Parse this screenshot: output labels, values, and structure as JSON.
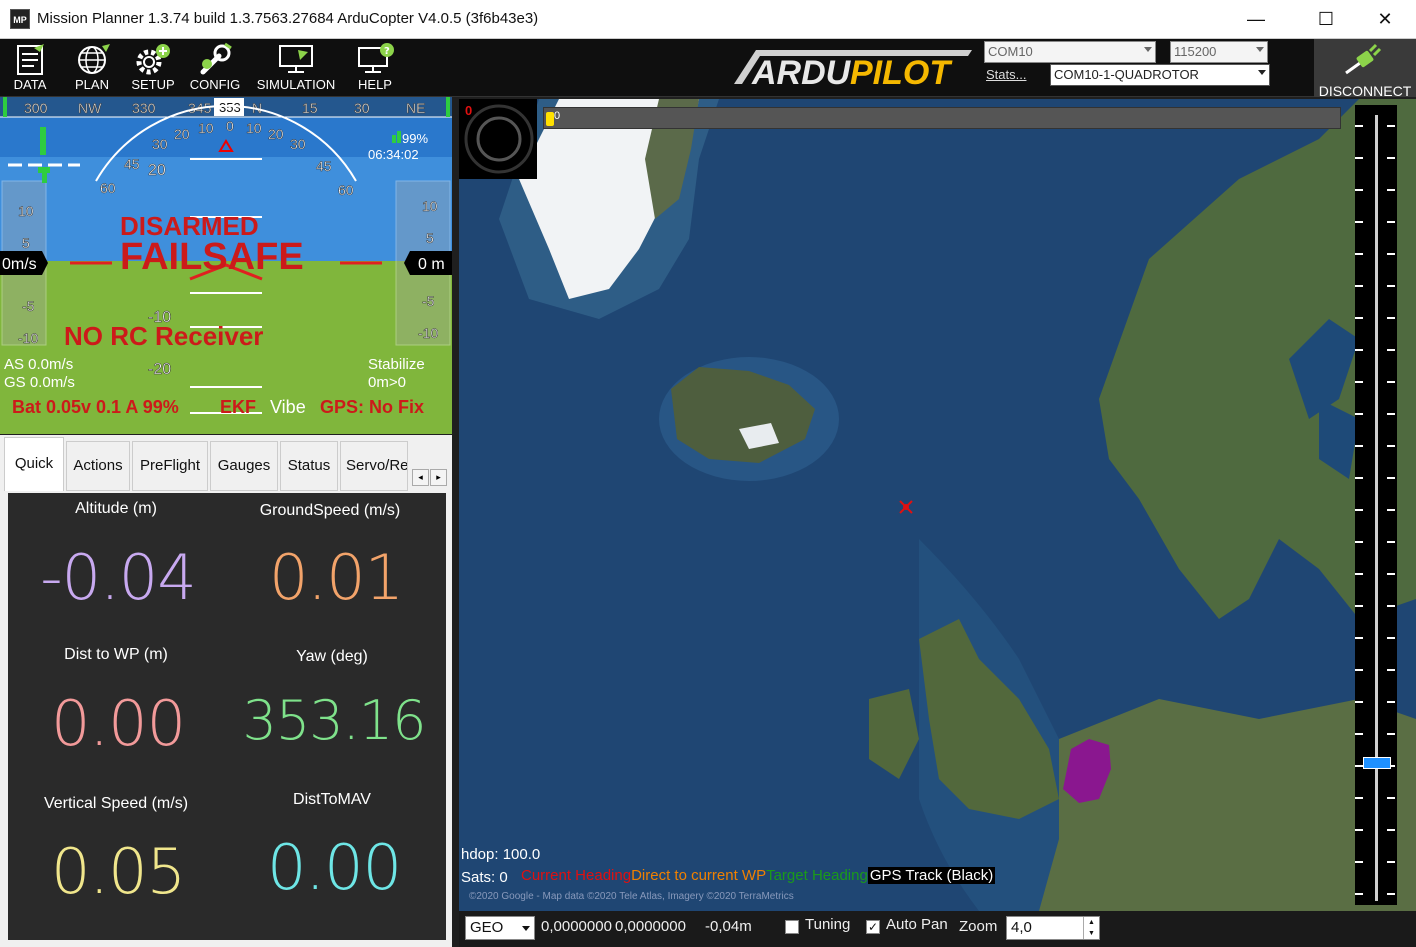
{
  "window": {
    "title": "Mission Planner 1.3.74 build 1.3.7563.27684 ArduCopter V4.0.5 (3f6b43e3)",
    "app_icon_text": "MP",
    "minimize": "—",
    "maximize": "☐",
    "close": "✕"
  },
  "toolbar": {
    "buttons": [
      {
        "label": "DATA",
        "icon": "data-icon"
      },
      {
        "label": "PLAN",
        "icon": "globe-icon"
      },
      {
        "label": "SETUP",
        "icon": "gear-plus-icon"
      },
      {
        "label": "CONFIG",
        "icon": "wrench-icon"
      },
      {
        "label": "SIMULATION",
        "icon": "monitor-icon"
      },
      {
        "label": "HELP",
        "icon": "help-monitor-icon"
      }
    ],
    "logo_text": "ARDUPILOT",
    "port": "COM10",
    "baud": "115200",
    "stats_link": "Stats...",
    "device": "COM10-1-QUADROTOR",
    "disconnect_label": "DISCONNECT"
  },
  "hud": {
    "heading_ticks": [
      "300",
      "NW",
      "330",
      "345",
      "353",
      "N",
      "15",
      "30",
      "NE"
    ],
    "heading_value": "353",
    "roll_ticks_left": [
      "60",
      "45",
      "30",
      "20",
      "10"
    ],
    "roll_ticks_right": [
      "0",
      "10",
      "20",
      "30",
      "45",
      "60"
    ],
    "pitch_marks": [
      "20",
      "-10",
      "-20"
    ],
    "speed_scale": [
      "10",
      "5",
      "-5",
      "-10"
    ],
    "speed_value": "0m/s",
    "alt_scale": [
      "10",
      "5",
      "-5",
      "-10"
    ],
    "alt_value": "0 m",
    "signal_pct": "99%",
    "time": "06:34:02",
    "status_disarmed": "DISARMED",
    "status_failsafe": "FAILSAFE",
    "status_norc": "NO RC Receiver",
    "airspeed": "AS 0.0m/s",
    "groundspeed": "GS 0.0m/s",
    "mode": "Stabilize",
    "wp_dist": "0m>0",
    "battery": "Bat 0.05v 0.1 A 99%",
    "ekf": "EKF",
    "vibe": "Vibe",
    "gps": "GPS: No Fix",
    "colors": {
      "sky": "#2c7fd0",
      "ground": "#7fb53a",
      "warning": "#cc1a1a"
    }
  },
  "tabs": [
    "Quick",
    "Actions",
    "PreFlight",
    "Gauges",
    "Status",
    "Servo/Re"
  ],
  "quick": [
    {
      "label": "Altitude (m)",
      "value": "-0.04",
      "color": "#c8a9f0"
    },
    {
      "label": "GroundSpeed (m/s)",
      "value": "0.01",
      "color": "#f2a36a"
    },
    {
      "label": "Dist to WP (m)",
      "value": "0.00",
      "color": "#f29a9a"
    },
    {
      "label": "Yaw (deg)",
      "value": "353.16",
      "color": "#7fe28b"
    },
    {
      "label": "Vertical Speed (m/s)",
      "value": "0.05",
      "color": "#f0e68c"
    },
    {
      "label": "DistToMAV",
      "value": "0.00",
      "color": "#6ee6e6"
    }
  ],
  "map": {
    "progress_label": "0",
    "scale_label": "0",
    "hdop": "hdop: 100.0",
    "sats": "Sats: 0",
    "legend": [
      {
        "text": "Current Heading",
        "color": "#e01010"
      },
      {
        "text": "Direct to current WP",
        "color": "#f08000"
      },
      {
        "text": "Target Heading",
        "color": "#1a9a1a"
      },
      {
        "text": "GPS Track (Black)",
        "color": "#ffffff"
      }
    ],
    "copyright": "©2020 Google - Map data ©2020 Tele Atlas, Imagery ©2020 TerraMetrics"
  },
  "statusbar": {
    "coord_system": "GEO",
    "lat": "0,0000000",
    "lon": "0,0000000",
    "alt": "-0,04m",
    "tuning_label": "Tuning",
    "tuning_checked": false,
    "autopan_label": "Auto Pan",
    "autopan_checked": true,
    "zoom_label": "Zoom",
    "zoom_value": "4,0"
  }
}
